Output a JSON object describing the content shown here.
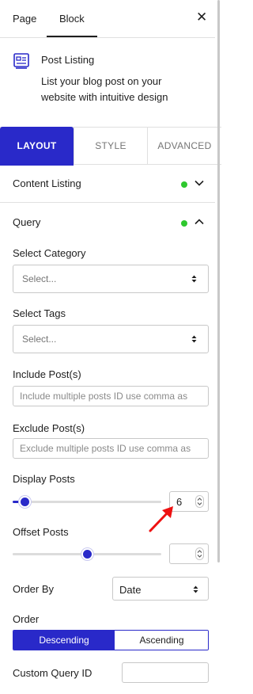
{
  "tabs": {
    "page": "Page",
    "block": "Block"
  },
  "close_icon": "close-icon",
  "block": {
    "icon": "post-listing-icon",
    "name": "Post Listing",
    "description": "List your blog post on your website with intuitive design"
  },
  "settings_tabs": [
    "LAYOUT",
    "STYLE",
    "ADVANCED"
  ],
  "active_settings_tab": "LAYOUT",
  "sections": {
    "content_listing": {
      "title": "Content Listing",
      "expanded": false
    },
    "query": {
      "title": "Query",
      "expanded": true
    }
  },
  "status_dot_color": "#2ec82e",
  "accent_color": "#2929c9",
  "fields": {
    "select_category": {
      "label": "Select Category",
      "value": "Select..."
    },
    "select_tags": {
      "label": "Select Tags",
      "value": "Select..."
    },
    "include_posts": {
      "label": "Include Post(s)",
      "placeholder": "Include multiple posts ID use comma as"
    },
    "exclude_posts": {
      "label": "Exclude Post(s)",
      "placeholder": "Exclude multiple posts ID use comma as"
    },
    "display_posts": {
      "label": "Display Posts",
      "value": "6",
      "slider_fraction": 0.08
    },
    "offset_posts": {
      "label": "Offset Posts",
      "value": "",
      "slider_fraction": 0.5
    },
    "order_by": {
      "label": "Order By",
      "value": "Date"
    },
    "order": {
      "label": "Order",
      "options": [
        "Descending",
        "Ascending"
      ],
      "selected": "Descending"
    },
    "custom_query_id": {
      "label": "Custom Query ID",
      "value": ""
    }
  },
  "annotation": {
    "type": "red-arrow",
    "points_to": "display-posts-number"
  }
}
